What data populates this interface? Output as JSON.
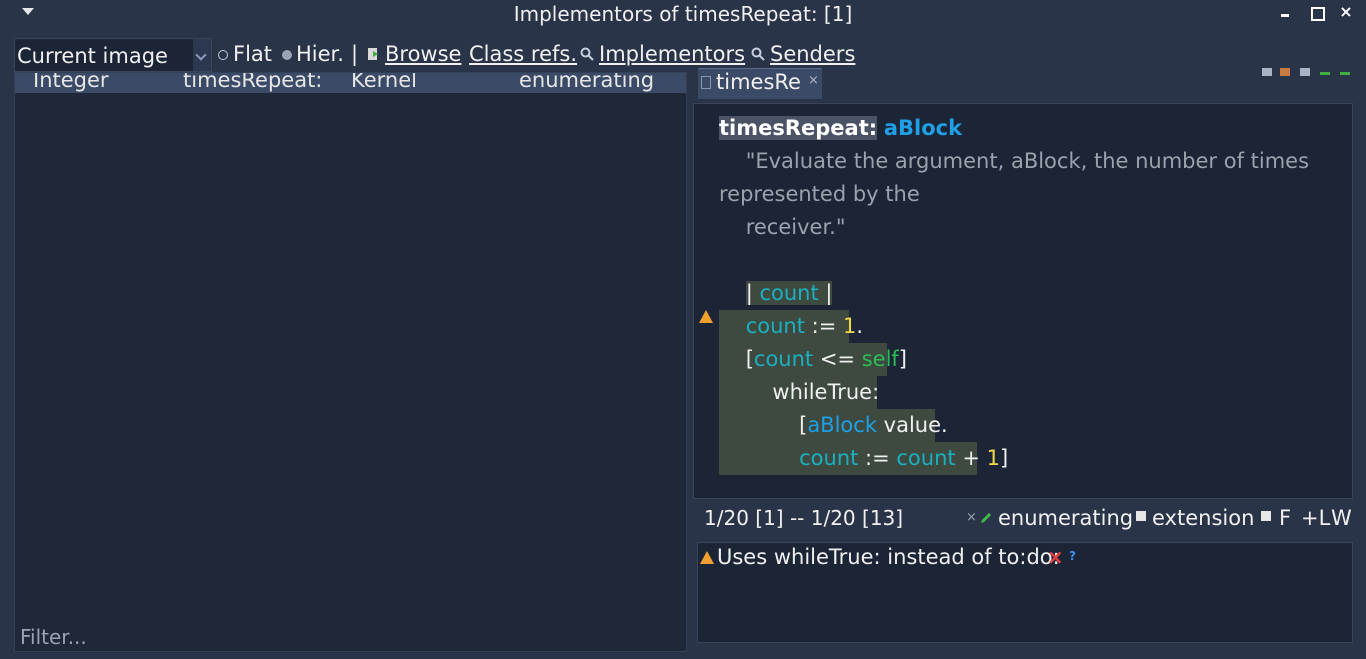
{
  "window": {
    "title": "Implementors of timesRepeat: [1]"
  },
  "toolbar": {
    "scope_value": "Current image",
    "flat_label": "Flat",
    "hier_label": "Hier.",
    "separator": "|",
    "browse_label": "Browse",
    "class_refs_label": "Class refs.",
    "implementors_label": "Implementors",
    "senders_label": "Senders"
  },
  "results": {
    "rows": [
      {
        "class": "Integer",
        "selector": "timesRepeat:",
        "package": "Kernel",
        "protocol": "enumerating"
      }
    ],
    "filter_placeholder": "Filter..."
  },
  "editor": {
    "tab_label": "timesRe",
    "tab_close": "×",
    "code": {
      "selector": "timesRepeat:",
      "arg": "aBlock",
      "comment_1": "\"Evaluate the argument, aBlock, the number of times",
      "comment_2": "represented by the",
      "comment_3": "receiver.\"",
      "temp_open": "| ",
      "temp_var": "count",
      "temp_close": " |",
      "assign_var": "count",
      "assign_op": " := ",
      "assign_val": "1",
      "period": ".",
      "cond_open": "[",
      "cond_var": "count",
      "cond_op": " <= ",
      "cond_self": "self",
      "cond_close": "]",
      "while_kw": "whileTrue:",
      "body_open": "[",
      "body_block": "aBlock",
      "body_msg": " value",
      "body_period": ".",
      "inc_var": "count",
      "inc_op": " := ",
      "inc_var2": "count",
      "inc_plus": " + ",
      "inc_val": "1",
      "inc_close": "]"
    }
  },
  "status": {
    "position": "1/20 [1] -- 1/20 [13]",
    "close_x": "×",
    "protocol": "enumerating",
    "extension": "extension",
    "f": "F",
    "l": "+L",
    "w": "W"
  },
  "critic": {
    "message": "Uses whileTrue: instead of to:do:",
    "ban_icon": "×",
    "help_icon": "?"
  },
  "colors": {
    "background": "#2a3448",
    "pane": "#1e2839",
    "selection_row": "#3b4a66",
    "argument": "#1e9fe6",
    "variable": "#1ab0c0",
    "number": "#f0d848",
    "keyword": "#2bbd55",
    "comment": "#9ba2ad",
    "warning": "#f0a030",
    "error": "#e23c3c"
  },
  "icons": [
    "menu-arrow-icon",
    "minimize-icon",
    "maximize-icon",
    "close-icon",
    "browse-icon",
    "magnifier-icon",
    "document-icon",
    "warning-icon",
    "pencil-icon",
    "ban-icon",
    "help-icon"
  ]
}
